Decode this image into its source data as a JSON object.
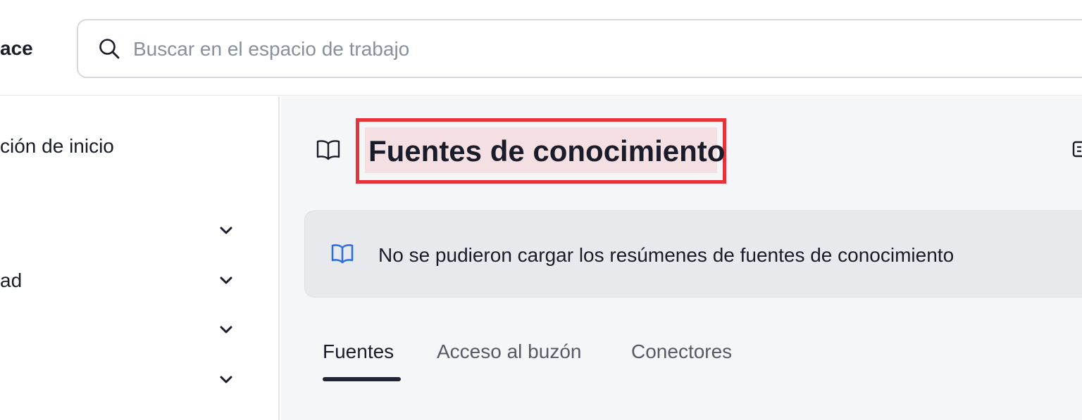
{
  "header": {
    "brand": "ace",
    "search": {
      "placeholder": "Buscar en el espacio de trabajo",
      "icon": "search-icon"
    }
  },
  "sidebar": {
    "items": [
      {
        "label": "ción de inicio",
        "has_chevron": false
      },
      {
        "label": "",
        "has_chevron": true
      },
      {
        "label": "ad",
        "has_chevron": true
      },
      {
        "label": "",
        "has_chevron": true
      },
      {
        "label": "",
        "has_chevron": true
      }
    ]
  },
  "main": {
    "title": "Fuentes de conocimiento",
    "title_icon": "book-open-icon",
    "alert": {
      "icon": "book-open-icon",
      "message": "No se pudieron cargar los resúmenes de fuentes de conocimiento"
    },
    "tabs": [
      {
        "label": "Fuentes",
        "active": true
      },
      {
        "label": "Acceso al buzón",
        "active": false
      },
      {
        "label": "Conectores",
        "active": false
      }
    ]
  },
  "colors": {
    "highlight_border": "#e5323b",
    "alert_icon": "#2f6fe0",
    "text": "#1a1d29",
    "background": "#f5f6f8"
  }
}
